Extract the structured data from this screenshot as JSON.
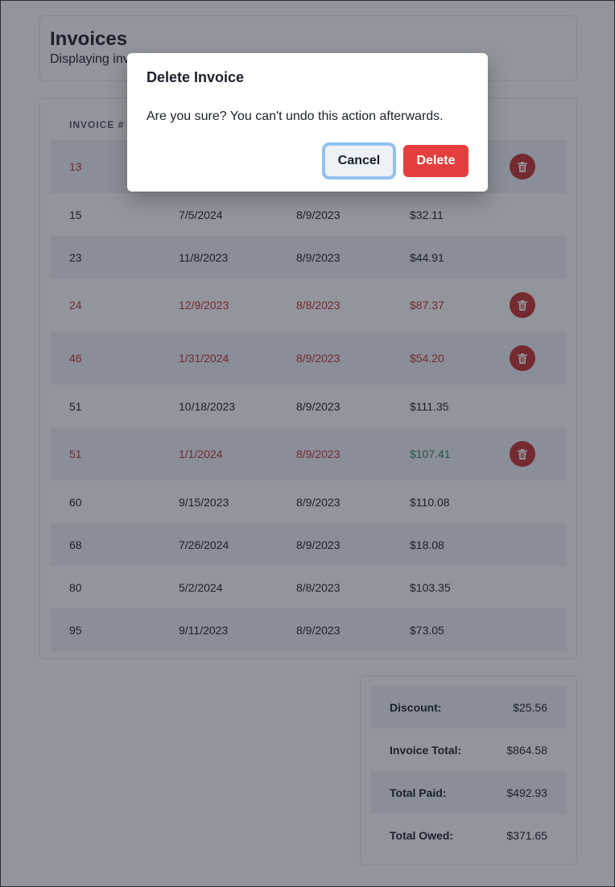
{
  "header": {
    "title": "Invoices",
    "subtitle": "Displaying invoices"
  },
  "table": {
    "columns": [
      "Invoice #"
    ],
    "rows": [
      {
        "number": "13",
        "due": "",
        "created": "",
        "amount": "",
        "status": "overdue",
        "deletable": true
      },
      {
        "number": "15",
        "due": "7/5/2024",
        "created": "8/9/2023",
        "amount": "$32.11",
        "status": "normal",
        "deletable": false
      },
      {
        "number": "23",
        "due": "11/8/2023",
        "created": "8/9/2023",
        "amount": "$44.91",
        "status": "normal",
        "deletable": false
      },
      {
        "number": "24",
        "due": "12/9/2023",
        "created": "8/8/2023",
        "amount": "$87.37",
        "status": "overdue",
        "deletable": true
      },
      {
        "number": "46",
        "due": "1/31/2024",
        "created": "8/9/2023",
        "amount": "$54.20",
        "status": "overdue",
        "deletable": true
      },
      {
        "number": "51",
        "due": "10/18/2023",
        "created": "8/9/2023",
        "amount": "$111.35",
        "status": "normal",
        "deletable": false
      },
      {
        "number": "51",
        "due": "1/1/2024",
        "created": "8/9/2023",
        "amount": "$107.41",
        "status": "overdue-paid",
        "deletable": true
      },
      {
        "number": "60",
        "due": "9/15/2023",
        "created": "8/9/2023",
        "amount": "$110.08",
        "status": "normal",
        "deletable": false
      },
      {
        "number": "68",
        "due": "7/26/2024",
        "created": "8/9/2023",
        "amount": "$18.08",
        "status": "normal",
        "deletable": false
      },
      {
        "number": "80",
        "due": "5/2/2024",
        "created": "8/8/2023",
        "amount": "$103.35",
        "status": "normal",
        "deletable": false
      },
      {
        "number": "95",
        "due": "9/11/2023",
        "created": "8/9/2023",
        "amount": "$73.05",
        "status": "normal",
        "deletable": false
      }
    ]
  },
  "summary": {
    "discount_label": "Discount:",
    "discount_value": "$25.56",
    "total_label": "Invoice Total:",
    "total_value": "$864.58",
    "paid_label": "Total Paid:",
    "paid_value": "$492.93",
    "owed_label": "Total Owed:",
    "owed_value": "$371.65"
  },
  "modal": {
    "title": "Delete Invoice",
    "body": "Are you sure? You can't undo this action afterwards.",
    "cancel_label": "Cancel",
    "delete_label": "Delete"
  },
  "colors": {
    "overdue": "#c53030",
    "paid": "#2f855a",
    "delete_button": "#e53e3e",
    "stripe": "#edf2f7"
  },
  "icons": {
    "row_action": "trash-icon"
  }
}
